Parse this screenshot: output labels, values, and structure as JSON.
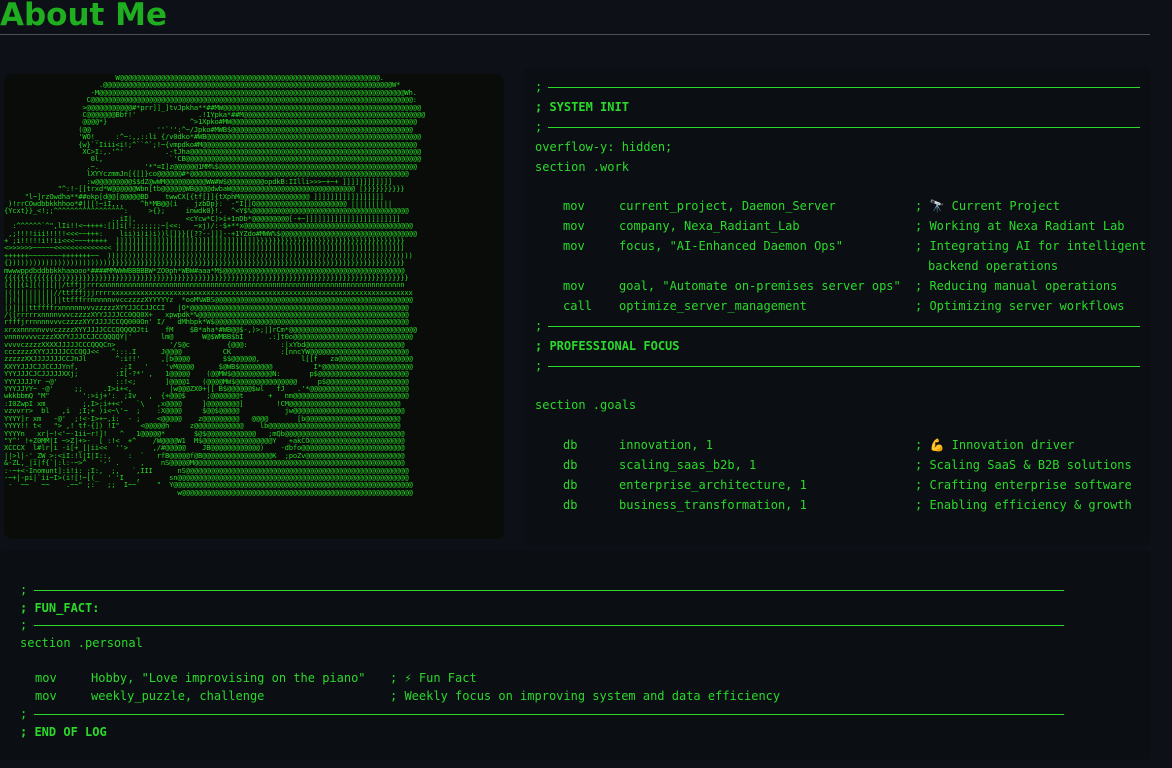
{
  "page": {
    "title": "About Me"
  },
  "ascii_art": {
    "lines": [
      "                           W@@@@@@@@@@@@@@@@@@@@@@@@@@@@@@@@@@@@@@@@@@@@@@@@@@@@@@@@@@@@@@@.",
      "                       .@@@@@@@@@@@@@@@@@@@@@@@@@@@@@@@@@@@@@@@@@@@@@@@@@@@@@@@@@@@@@@@@@@@@@@W*",
      "                     -M@@@@@@@@@@@@@@@@@@@@@@@@@@@@@@@@@@@@@@@@@@@@@@@@@@@@@@@@@@@@@@@@@@@@@@@@@@Wh.",
      "                    C@@@@@@@@@@@@@@@@@@@@@@@@@@@@@@@@@@@@@@@@@@@@@@@@@@@@@@@@@@@@@@@@@@@@@@@@@@@@@@:",
      "                   >@@@@@@@@@@@#*prr]]_]tvJpkha**##MW@@@@@@@@@@@@@@@@@@@@@@@@@@@@@@@@@@@@@@@@@@@@@@@@",
      "                   C@@@@@@@Bbf!'               .!1Ypka*##M@@@@@@@@@@@@@@@@@@@@@@@@@@@@@@@@@@@@@@@@@@@@",
      "                   @@@@*}                    ^>1Xpko#MW@@@@@@@@@@@@@@@@@@@@@@@@@@@@@@@@@@@@@@@@@@@@@",
      "                  (@@                ''`'':^~/Jpko#MWB$@@@@@@@@@@@@@@@@@@@@@@@@@@@@@@@@@@@@@@@@@@@@",
      "                  'WO!_    :^~:,,::li {/v0dko*#WB@@@@@@@@@@@@@@@@@@@@@@@@@@@@@@@@@@@@@@@@@@@@@@@@@@@@",
      "                  {w}`'Iiii<i!;^``^`;!~{vmpdko#M@@@@@@@@@@@@@@@@@@@@@@@@@@@@@@@@@@@@@@@@@@@@@@@@@@@@",
      "                   XC>I:,.'^'          .-tJha@@@@@@@@@@@@@@@@@@@@@@@@@@@@@@@@@@@@@@@@@@@@@@@@@@@@@@@@",
      "                     0l,                `'CB@@@@@@@@@@@@@@@@@@@@@@@@@@@@@@@@@@@@@@@@@@@@@@@@@@@@@@@@@",
      "                    .~.           '*\"=I]z@@@@@@1MM%$@@@@@@@@@@@@@@@@@@@@@@@@@@@@@@@@@@@@@@@@@@@@@@@@",
      "                    lXYYczmmJn[{[]}co@@@@@@#*@@@@@@@@@@@@@@@@@@@@@@@@@@@@@@@@@@@@@@@@@@@@@@@@@@@@@",
      "                    :w@@@@@@@@@$$dZ@wWM@@@@@@@@@@WW#W$@@@@@@@@@opdkB:IIlli>>>~+~+ ]]]]]]]]]]]]",
      "             \"^:!-[[trxd*W@@@@@@Wbn[tb@@@@@@WB@@@@dwbaW@@@@@@@@@@@@@@@@@@@@@@@@@@@@@@ [}}}}}}}}}}",
      "     \"l~]rzOwdha**##okp[d@@[@@@@@BD    twwCX[{tf[]]{tXphM@@@@@@@@@@@@@@@@@ ]]]]]]]]]]]]]]]]]",
      " )!rrCOwdbbkkhhoo*#||[!~iI,,,    ^h*MB@@(i    jzbDp}:  -\"I[]Q@@@@@@@@@@@@@@@@@@@@@@ ||||||||||",
      "{Ycxt}}_<!;;^^^^^^^^^^^^^^^^^:     >{};     inwdk0}!.  ^<Y$%@@@@@@@@@@@@@@@@@@@@@@@@@@@@@@@@@@@@@@",
      "                          .,iI|,            <cYcw*C)>i+1nDb*@@@@@@@@@[-+~]]]]]]]]]]]]]]]]]]]]]]]",
      "  :^^^^^^`^\",lIi!!<~++++:[]]i[!;;;;;;;~[<<:   ~xj)/:-$+**x@@@@@@@@@@@@@@@@@@@@@@@@@@@@@@@@@@@@@@@@@",
      " ,;!!!!iii!!!!!<<<~~+++:    lii)i)i)i))l[]}}[[??--]]]--+1YZdo#MWW%$@@@@@@@@@@@@@@@@@@@@@@@@@@@@@@@@@",
      "+ ;i!!!!!i!!ii<<<~~~+++++  ]]]]]]]]]]]]]]]]]]]]]]]]]]]]]]]]]]}}}}}}}}}}}}}}}}}}}}}}}}}}}}}}}}}}}}",
      "<>>>>>>~~~~~<<<<<<<<<<<<<< ]]]]]]]]]]]]]]]]]]]]]]]]]]]]]]]]]]]]]]]]]]]]]]]]]]]]]]]]]]]]]]]]]]]]]]",
      "++++++~~~~~~~~+++++++~~  ))))))))))))))))))))))))))))))))))))))))))))))))))))))))))))))))))))))))))",
      "{}))))))))))))))))))))))))}}}}}}}}}}}}}}}}}}}}}}}}}}}}}}}}}}}}}}}}}}}}}}}}}}}}}}}}}}}}}}}}}}}}}}}",
      "mwwwppdbddbbkkhaaooo*####MMWWWBBBBBW*ZO0ph*WBW#aaa*M$@@@@@@@@@@@@@@@@@@@@@@@@@@@@@@@@@@@@@@@@@@@@",
      "{{{{{{{{{{{{{}}}}}}}}}}}}}}}}}}}}}}}}}}}}}}}}}}}}}}}}}}}}}}}}}}}}}}}}}}}}}}}}}}}}}}}}}}}}}}}}}}}}}",
      "[{|[{i][(|][||/tffjjrrrxnnnnnnnnnnnnnnnnnnnnnnnnnnnnnnnnnnnnnnnnnnnnnnnnnnnnnnnnnnnnnnnnnnnnnnnnn",
      "|(|(||||||||//ttfffjjjrrrrxxxxxxxxxxxxxxxxxxxxxxxxxxxxxxxxxxxxxxxxxxxxxxxxxxxxxxxxxxxxxxxxxxxxxxxxx",
      "||(|||||||||||ttfffrrnnnnnvvcczzzzXYYYYYz  *ooM%WBS@@@@@@@@@@@@@@@@@@@@@@@@@@@@@@@@@@@@@@@@@@@@@@@@",
      "|)||||ttffffrxnnnnnvvvzzzzzXYYJJCCJJCCI   |O*@@@@@@@@@@@@@@@@@@@@@@@@@@@@@@@@@@@@@@@@@@@@@@@@@@@@@",
      "/([rrrrrxnnnnvvvczzzzXYYJJJJCC0QQ0X+   xpwpdk*%@@@@@@@@@@@@@@@@@@@@@@@@@@@@@@@@@@@@@@@@@@@@@@@@@@@",
      "rfffjrrnnnnvvvczzzzXYYJJJJCCQQ000On' I/   dMhbpk*W$@@@@@@@@@@@@@@@@@@@@@@@@@@@@@@@@@@@@@@@@@@@@@@@",
      "xrxxnnnnnvvvczzzzXYYJJJJCCCQQQQQJti    fM    $B*aha*#WB@@$-,)>;|]rCm*@@@@@@@@@@@@@@@@@@@@@@@@@@@@@@@",
      "vnnnvvvvczzzXXYYJJJCCJCCQQQQY|'       lm@       W@$WMBB$bI      .:]t0o@@@@@@@@@@@@@@@@@@@@@@@@@@@@@",
      "vvvvczzzzXXXXJJJJJCCCQQQCn>             '/S@c         {@@@:        :|xYbd@@@@@@@@@@@@@@@@@@@@@@@@",
      "ccczzzzXYYJJJJJCCCQQJ<<   ^:::.I      J@@@@          CK            :[nncYW@@@@@@@@@@@@@@@@@@@@@@@@",
      "zzzzzXXJJJJJJJCCJnJl       ^:i!!'     ,[b@@@@        $$@@@@@@,          l[[f   za@@@@@@@@@@@@@@@@@@",
      "XXYYJJJCJJCCJJYnf,          .;I   '    'vM@@@@      $@WB$@@@@@@@@          I*@@@@@@@@@@@@@@@@@@@@@@",
      "YYYJJJCJCJJJJJXXj;         :I[-?*' ,   1@@@@@    (@@MW$@@@@@@@@@@N:       p$@@@@@@@@@@@@@@@@@@@@@@",
      "YYYJJJJYr ~@'              ::!<;       ]@@@@1   (@@@@MW$@@@@@@@@@@@@@@@     p$@@@@@@@@@@@@@@@@@@@@",
      "YYYJJYY~ -@'     ;;     .I>i+<,         |w@@@ZX0+|[ B$@@@@@@$wl   fJ   .'*@@@@@@@@@@@@@@@@@@@@@@@@",
      "wkkbbmQ \"M\"        ':>ij+':  ;Iv   ,  {+@@@$     ;@@@@@@@t      +   nm@@@@@@@@@@@@@@@@@@@@@@@@@@@@",
      ":I0ZwpI xm         ;,I>;i++<'   `\\   ,x@@@@     ]@@@@@@@@]        !CM@@@@@@@@@@@@@@@@@@@@@@@@@@@",
      "vzvvrr>  bl   ,i  ;I;+ )i<~\\'~  ;    :X@@@@     $@@$@@@@@           jw@@@@@@@@@@@@@@@@@@@@@@@@@@@",
      "YYYY]r xm   -@'  ;!<-I>+~,i:  - ;    <@@@@@    z@@@@@@@@@   @@@@       [b@@@@@@@@@@@@@@@@@@@@@@@",
      "YYYY!! t<   \"> ,! tf-{]) !I\"     <@@@@@h     z@@@@@@@@@@@@    lb@@@@@@@@@@@@@@@@@@@@@@@@@@@@@@@@",
      "YYYYn   xr|~!<'~-1ii~r!]!   ^   1@@@@@*       $@$@@@@@@@@@@@@   ;mQb@@@@@@@@@@@@@@@@@@@@@@@@@@@@@",
      "\"Y^' !+Z0MM|I ~>Z|+>-  [ :!<  +^    /W@@@@W1  M$@@@@@@@@@@@@@@@@@Y   +akCO@@@@@@@@@@@@@@@@@@@@@@@",
      "XCCCX  l#lr|i -i[+_[|ii<<  ''>      ,/#@@@@@    JB@@@@@@@@@@@@)    -dbfo@@@@@@@@@@@@@@@@@@@@@@@@@",
      "||>l|-'_ZW >:<iI:!l|I|I::,    :  `   rfB@@@@@f@B@@@@@@@@@@@@@@@@@K  ;poZv@@@@@@@@@@@@@@@@@@@@@@@@",
      "&-ZL,_|i|f{`|:l:-~>^   '-' .     ,    nS@@@@@M@@@@@@@@@@@@@@@@@@@@@@@@@@@@@@@@@@@@@@@@@@@@@@@@@@@",
      ":-~+<-Inomunt]:i!i: ;I:,  ;,   `,III      nS@@@@@@@@@@@@@@@@@@@@@@@@@@@@@@@@@@@@@@@@@@@@@@@@@@@@@@",
      "-~+|-pi|`ii~I>(i![!~[(_  ' 'I   ,       sn@@@@@@@@@@@@@@@@@@@@@@@@@@@@@@@@@@@@@@@@@@@@@@@@@@@@@@@@",
      " -  ~~   ~~    .~~\" ;:   ;;  I~~`    \"  Y@@@@@@@@@@@@@@@@@@@@@@@@@@@@@@@@@@@@@@@@@@@@@@@@@@@@@@@@@@",
      "                                          w@@@@@@@@@@@@@@@@@@@@@@@@@@@@@@@@@@@@@@@@@@@@@@@@@@@@@@@@"
    ]
  },
  "top_terminal": {
    "rule_prefix": ";",
    "header1_label": "; SYSTEM INIT",
    "directive": "overflow-y: hidden;",
    "section_work": "section .work",
    "work_rows": [
      {
        "op": "mov",
        "args": "current_project, Daemon_Server",
        "comment": "; 🔭 Current Project"
      },
      {
        "op": "mov",
        "args": "company, Nexa_Radiant_Lab",
        "comment": "; Working at Nexa Radiant Lab"
      },
      {
        "op": "mov",
        "args": "focus, \"AI-Enhanced Daemon Ops\"",
        "comment": "; Integrating AI for intelligent",
        "comment2": "backend operations"
      },
      {
        "op": "mov",
        "args": "goal, \"Automate on-premises server ops\"",
        "comment": "; Reducing manual operations"
      },
      {
        "op": "call",
        "args": "optimize_server_management",
        "comment": "; Optimizing server workflows"
      }
    ],
    "header2_label": "; PROFESSIONAL FOCUS",
    "section_goals": "section .goals",
    "goal_rows": [
      {
        "op": "db",
        "args": "innovation, 1",
        "comment": "; 💪 Innovation driver"
      },
      {
        "op": "db",
        "args": "scaling_saas_b2b, 1",
        "comment": "; Scaling SaaS & B2B solutions"
      },
      {
        "op": "db",
        "args": "enterprise_architecture, 1",
        "comment": "; Crafting enterprise software"
      },
      {
        "op": "db",
        "args": "business_transformation, 1",
        "comment": "; Enabling efficiency & growth"
      }
    ]
  },
  "bottom_terminal": {
    "rule_prefix": ";",
    "header_label": "; FUN_FACT:",
    "section_personal": "section .personal",
    "rows": [
      {
        "op": "mov",
        "args": "Hobby, \"Love improvising on the piano\"",
        "comment": "; ⚡ Fun Fact"
      },
      {
        "op": "mov",
        "args": "weekly_puzzle, challenge",
        "comment": "; Weekly focus on improving system and data efficiency"
      }
    ],
    "end_label": "; END OF LOG"
  }
}
